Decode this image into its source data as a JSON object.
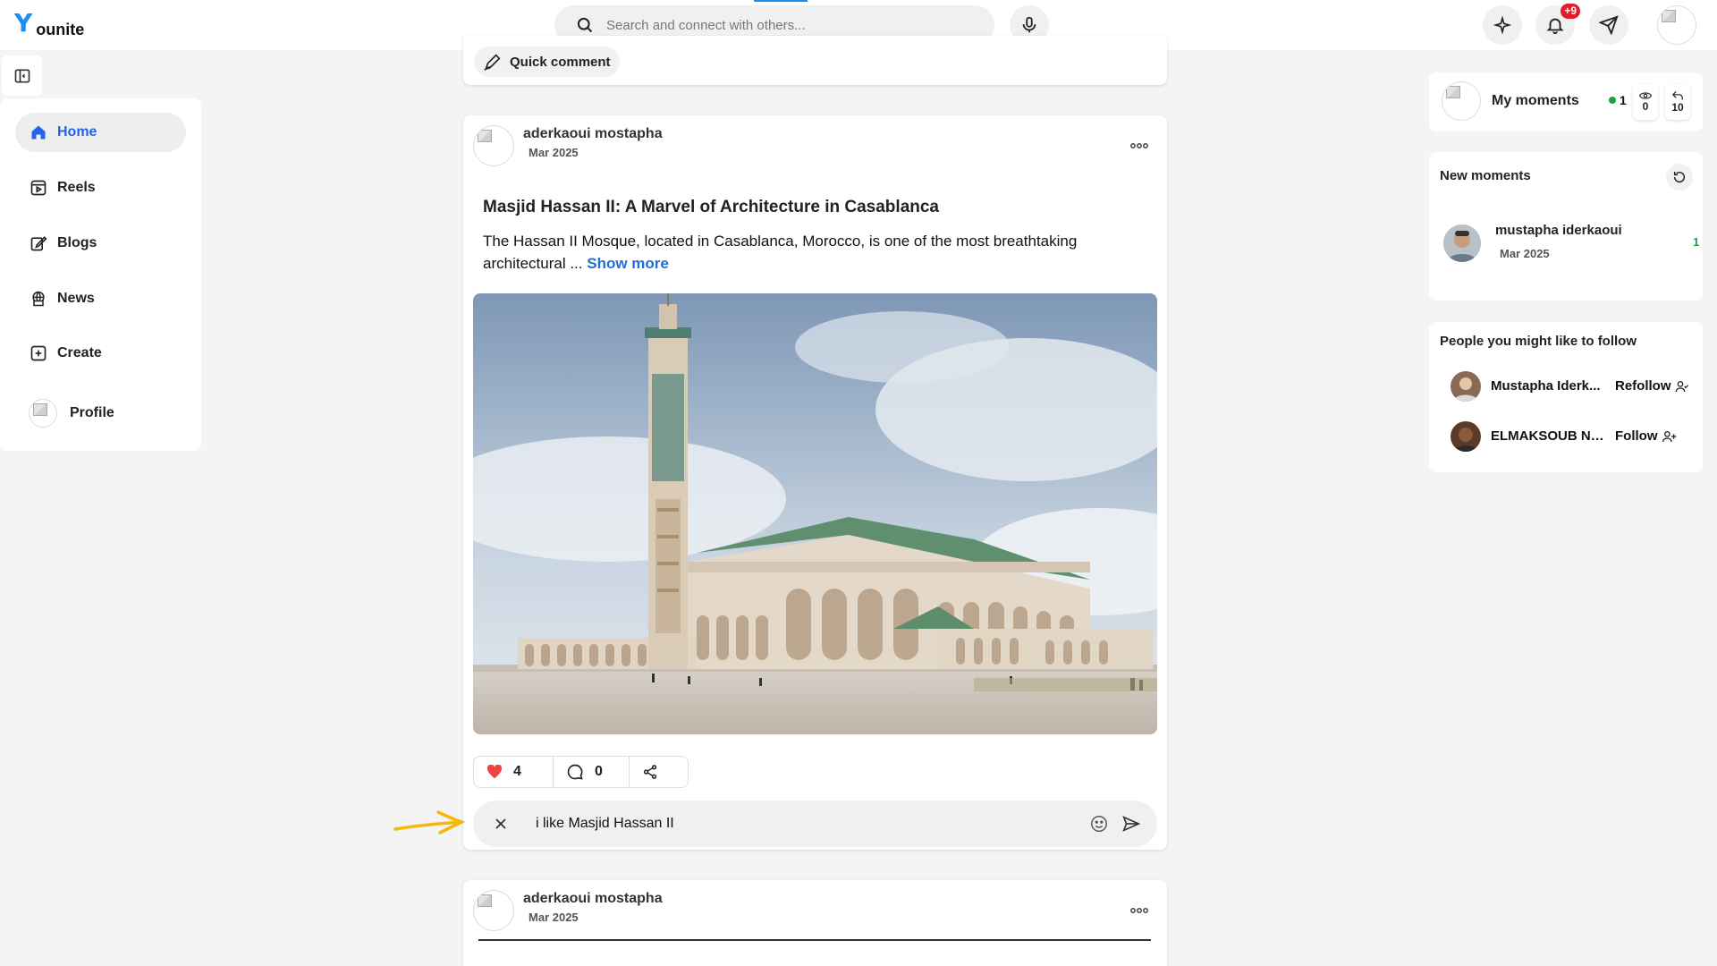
{
  "brand": {
    "logo_mark": "Y",
    "name": "ounite"
  },
  "search": {
    "placeholder": "Search and connect with others..."
  },
  "notifications": {
    "badge": "+9"
  },
  "sidebar": {
    "items": [
      {
        "label": "Home",
        "icon": "home-icon",
        "active": true
      },
      {
        "label": "Reels",
        "icon": "reels-icon"
      },
      {
        "label": "Blogs",
        "icon": "blogs-icon"
      },
      {
        "label": "News",
        "icon": "news-icon"
      },
      {
        "label": "Create",
        "icon": "create-icon"
      },
      {
        "label": "Profile",
        "icon": "avatar"
      }
    ]
  },
  "feed": {
    "quick_comment": "Quick comment",
    "post1": {
      "author": "aderkaoui mostapha",
      "date": "Mar 2025",
      "title": "Masjid Hassan II: A Marvel of Architecture in Casablanca",
      "text": "The Hassan II Mosque, located in Casablanca, Morocco, is one of the most breathtaking architectural ...",
      "show_more": "Show more",
      "likes": "4",
      "comments": "0",
      "comment_draft": "i like Masjid Hassan II"
    },
    "post2": {
      "author": "aderkaoui mostapha",
      "date": "Mar 2025"
    }
  },
  "right": {
    "my_moments": {
      "label": "My moments",
      "active_count": "1",
      "views": "0",
      "shares": "10"
    },
    "new_moments": {
      "title": "New moments",
      "items": [
        {
          "name": "mustapha iderkaoui",
          "date": "Mar 2025",
          "count": "1"
        }
      ]
    },
    "suggestions": {
      "title": "People you might like to follow",
      "items": [
        {
          "name": "Mustapha Iderk...",
          "action": "Refollow"
        },
        {
          "name": "ELMAKSOUB NO...",
          "action": "Follow"
        }
      ]
    }
  },
  "colors": {
    "accent": "#2563eb",
    "brand": "#1e8cf0",
    "badge": "#e11d2b",
    "like": "#ef4444",
    "online": "#16a34a"
  }
}
